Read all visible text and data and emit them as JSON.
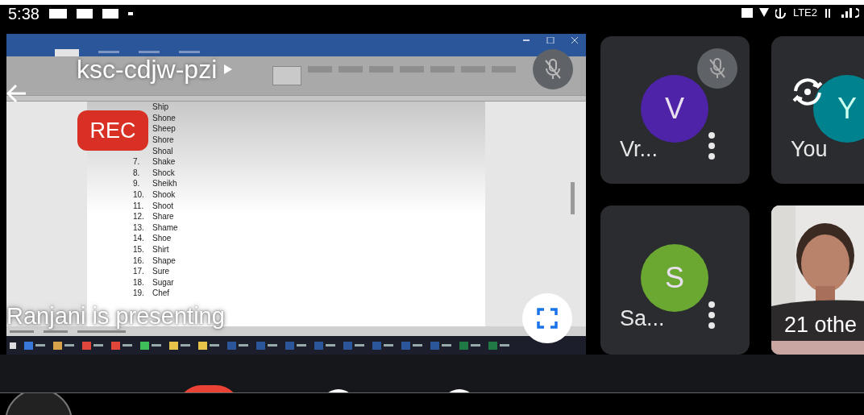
{
  "status_bar": {
    "time": "5:38",
    "network": "LTE2"
  },
  "presentation": {
    "meeting_code": "ksc-cdjw-pzi",
    "muted": true,
    "recording_badge": "REC",
    "presenter_caption": "Ranjani is presenting",
    "document_list": [
      {
        "word": "Ship"
      },
      {
        "word": "Shone"
      },
      {
        "word": "Sheep"
      },
      {
        "word": "Shore"
      },
      {
        "word": "Shoal"
      },
      {
        "number": "7.",
        "word": "Shake"
      },
      {
        "number": "8.",
        "word": "Shock"
      },
      {
        "number": "9.",
        "word": "Sheikh"
      },
      {
        "number": "10.",
        "word": "Shook"
      },
      {
        "number": "11.",
        "word": "Shoot"
      },
      {
        "number": "12.",
        "word": "Share"
      },
      {
        "number": "13.",
        "word": "Shame"
      },
      {
        "number": "14.",
        "word": "Shoe"
      },
      {
        "number": "15.",
        "word": "Shirt"
      },
      {
        "number": "16.",
        "word": "Shape"
      },
      {
        "number": "17.",
        "word": "Sure"
      },
      {
        "number": "18.",
        "word": "Sugar"
      },
      {
        "number": "19.",
        "word": "Chef"
      }
    ],
    "ribbon_tabs": [
      {
        "selected": true
      },
      {
        "selected": false
      },
      {
        "selected": false
      },
      {
        "selected": false
      }
    ]
  },
  "participants": [
    {
      "kind": "avatar",
      "initial": "V",
      "name": "Vr...",
      "color": "#4f23a8",
      "muted": true,
      "menu": true,
      "camera_switch": false
    },
    {
      "kind": "avatar",
      "initial": "Y",
      "name": "You",
      "color": "#00838f",
      "muted": false,
      "menu": false,
      "camera_switch": true
    },
    {
      "kind": "avatar",
      "initial": "S",
      "name": "Sa...",
      "color": "#6aa832",
      "muted": false,
      "menu": true,
      "camera_switch": false
    },
    {
      "kind": "video",
      "name": "21 othe"
    }
  ]
}
